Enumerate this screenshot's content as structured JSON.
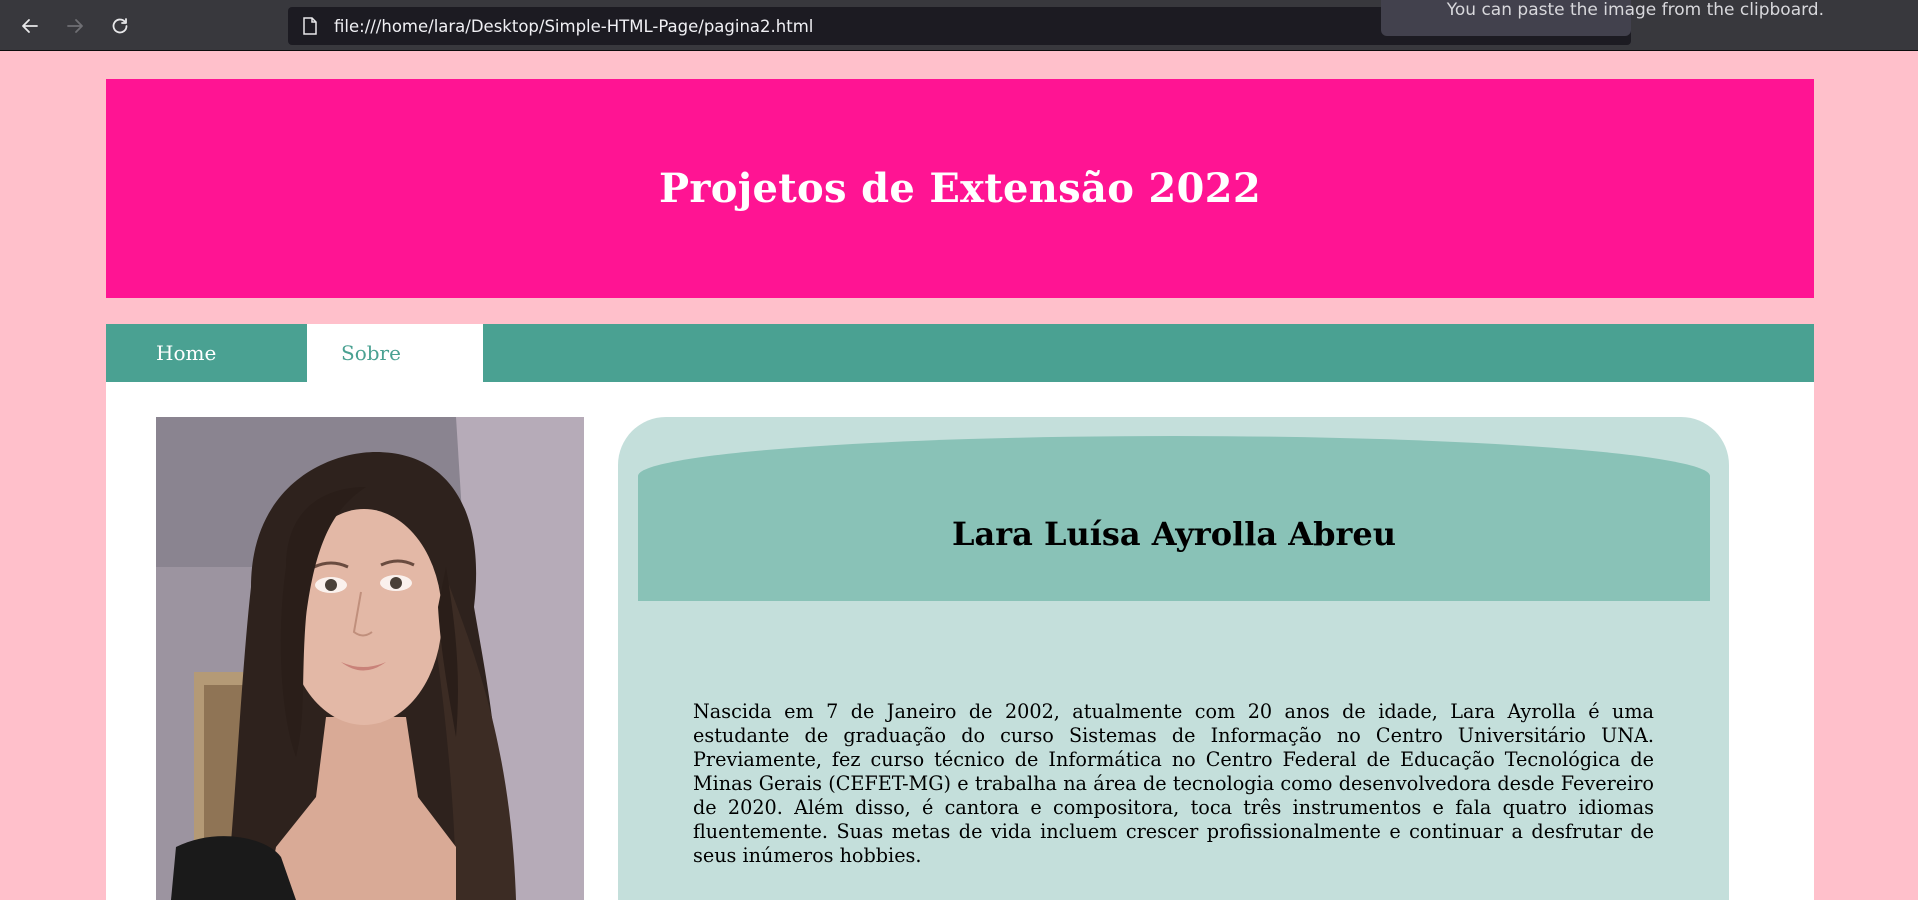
{
  "browser": {
    "url": "file:///home/lara/Desktop/Simple-HTML-Page/pagina2.html",
    "tooltip": "You can paste the image from the clipboard."
  },
  "header": {
    "title": "Projetos de Extensão 2022"
  },
  "nav": {
    "items": [
      {
        "label": "Home"
      },
      {
        "label": "Sobre"
      }
    ]
  },
  "profile": {
    "name": "Lara Luísa Ayrolla Abreu",
    "bio": "Nascida em 7 de Janeiro de 2002, atualmente com 20 anos de idade, Lara Ayrolla é uma estudante de graduação do curso Sistemas de Informação no Centro Universitário UNA. Previamente, fez curso técnico de Informática no Centro Federal de Educação Tecnológica de Minas Gerais (CEFET-MG) e trabalha na área de tecnologia como desenvolvedora desde Fevereiro de 2020. Além disso, é cantora e compositora, toca três instrumentos e fala quatro idiomas fluentemente. Suas metas de vida incluem crescer profissionalmente e continuar a desfrutar de seus inúmeros hobbies."
  }
}
